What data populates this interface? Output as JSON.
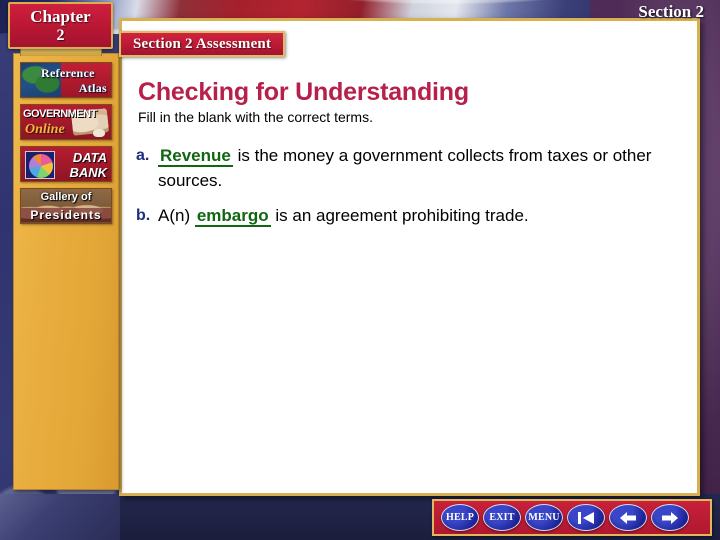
{
  "background": {
    "description": "us-flag-photo",
    "colors": {
      "flag_blue": "#2f3470",
      "flag_red": "#b22430",
      "purple": "#4e2c57"
    }
  },
  "chapter_plaque": {
    "word": "Chapter",
    "number": "2"
  },
  "section_title": "Section 2",
  "assessment_banner": {
    "label": "Section 2 Assessment"
  },
  "sidebar": {
    "items": [
      {
        "id": "reference-atlas",
        "line1": "Reference",
        "line2": "Atlas",
        "icon": "globe-map-icon"
      },
      {
        "id": "government-online",
        "line1": "GOVERNMENT",
        "line2": "Online",
        "icon": "book-mouse-icon"
      },
      {
        "id": "data-bank",
        "line1": "DATA",
        "line2": "BANK",
        "icon": "pie-chart-icon"
      },
      {
        "id": "gallery-of-presidents",
        "line1": "Gallery of",
        "line2": "Presidents",
        "icon": "presidents-portraits-icon"
      }
    ]
  },
  "main": {
    "heading": "Checking for Understanding",
    "subheading": "Fill in the blank with the correct terms.",
    "accent_color": "#b6204a",
    "blank_color": "#116611",
    "marker_color": "#1d2f7a",
    "questions": [
      {
        "marker": "a.",
        "before": "",
        "blank": "Revenue",
        "after": " is the money a government collects from taxes or other sources."
      },
      {
        "marker": "b.",
        "before": "A(n) ",
        "blank": "embargo",
        "after": "  is an agreement prohibiting trade."
      }
    ]
  },
  "navbar": {
    "buttons": [
      {
        "id": "help",
        "label": "HELP",
        "type": "text"
      },
      {
        "id": "exit",
        "label": "EXIT",
        "type": "text"
      },
      {
        "id": "menu",
        "label": "MENU",
        "type": "text"
      },
      {
        "id": "first",
        "label": "",
        "type": "icon",
        "icon": "first-slide-arrow-icon"
      },
      {
        "id": "previous",
        "label": "",
        "type": "icon",
        "icon": "previous-slide-arrow-icon"
      },
      {
        "id": "next",
        "label": "",
        "type": "icon",
        "icon": "next-slide-arrow-icon"
      }
    ]
  }
}
